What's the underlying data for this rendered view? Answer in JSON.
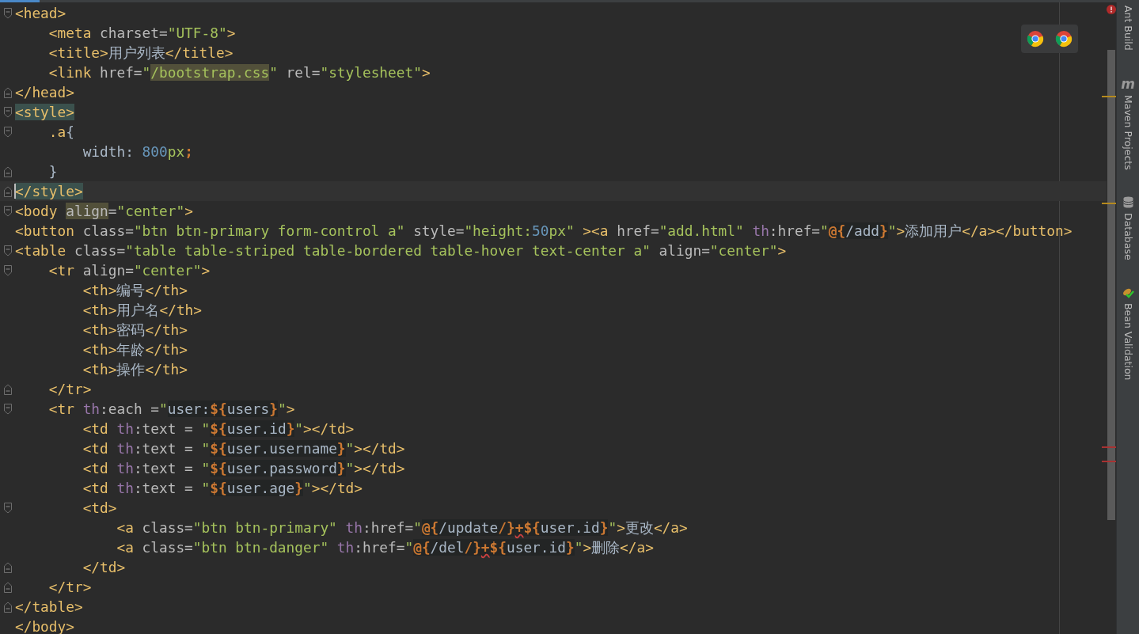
{
  "editor": {
    "lines": [
      {
        "fold_open": true,
        "tokens": [
          {
            "kind": "tag",
            "text": "<head>"
          }
        ],
        "children": [
          {
            "tokens": [
              {
                "kind": "tag",
                "text": "<meta"
              },
              {
                "kind": "attr",
                "text": " charset="
              },
              {
                "kind": "value",
                "text": "\"UTF-8\""
              },
              {
                "kind": "tag",
                "text": ">"
              }
            ]
          },
          {
            "tokens": [
              {
                "kind": "tag",
                "text": "<title>"
              },
              {
                "kind": "plain",
                "text": "用户列表"
              },
              {
                "kind": "tag",
                "text": "</title>"
              }
            ]
          },
          {
            "tokens": [
              {
                "kind": "tag",
                "text": "<link"
              },
              {
                "kind": "attr",
                "text": " href="
              },
              {
                "kind": "value",
                "text": "\""
              },
              {
                "kind": "value_usage",
                "text": "/bootstrap.css"
              },
              {
                "kind": "value",
                "text": "\""
              },
              {
                "kind": "attr",
                "text": " rel="
              },
              {
                "kind": "value",
                "text": "\"stylesheet\""
              },
              {
                "kind": "tag",
                "text": ">"
              }
            ]
          }
        ]
      },
      {
        "fold_close": true,
        "tokens": [
          {
            "kind": "tag",
            "text": "</head>"
          }
        ]
      },
      {
        "fold_open": true,
        "tokens": [
          {
            "kind": "tag_match",
            "text": "<style>"
          }
        ],
        "children": [
          {
            "fold_open": true,
            "tokens": [
              {
                "kind": "tag",
                "text": ".a"
              },
              {
                "kind": "plain",
                "text": "{"
              }
            ],
            "children": [
              {
                "tokens": [
                  {
                    "kind": "plain",
                    "text": "width: "
                  },
                  {
                    "kind": "number",
                    "text": "800"
                  },
                  {
                    "kind": "value",
                    "text": "px"
                  },
                  {
                    "kind": "punct",
                    "text": ";"
                  }
                ]
              }
            ]
          },
          {
            "fold_close": true,
            "tokens": [
              {
                "kind": "plain",
                "text": "}"
              }
            ]
          }
        ]
      },
      {
        "fold_close": true,
        "current": true,
        "tokens": [
          {
            "kind": "tag_match",
            "text": "</style>"
          }
        ]
      },
      {
        "fold_open": true,
        "tokens": [
          {
            "kind": "tag",
            "text": "<body "
          },
          {
            "kind": "attr_usage",
            "text": "align"
          },
          {
            "kind": "attr",
            "text": "="
          },
          {
            "kind": "value",
            "text": "\"center\""
          },
          {
            "kind": "tag",
            "text": ">"
          }
        ]
      },
      {
        "tokens": [
          {
            "kind": "tag",
            "text": "<button"
          },
          {
            "kind": "attr",
            "text": " class="
          },
          {
            "kind": "value",
            "text": "\"btn btn-primary form-control a\""
          },
          {
            "kind": "attr",
            "text": " style="
          },
          {
            "kind": "value",
            "text": "\"height:"
          },
          {
            "kind": "number",
            "text": "50"
          },
          {
            "kind": "value",
            "text": "px\""
          },
          {
            "kind": "tag",
            "text": " ><a"
          },
          {
            "kind": "attr",
            "text": " href="
          },
          {
            "kind": "value",
            "text": "\"add.html\""
          },
          {
            "kind": "prefix",
            "text": " th"
          },
          {
            "kind": "attr",
            "text": ":href="
          },
          {
            "kind": "value",
            "text": "\""
          },
          {
            "kind": "punct_expr",
            "text": "@{"
          },
          {
            "kind": "plain_expr",
            "text": "/add"
          },
          {
            "kind": "punct_expr",
            "text": "}"
          },
          {
            "kind": "value",
            "text": "\""
          },
          {
            "kind": "tag",
            "text": ">"
          },
          {
            "kind": "plain",
            "text": "添加用户"
          },
          {
            "kind": "tag",
            "text": "</a></button>"
          }
        ]
      },
      {
        "fold_open": true,
        "tokens": [
          {
            "kind": "tag",
            "text": "<table"
          },
          {
            "kind": "attr",
            "text": " class="
          },
          {
            "kind": "value",
            "text": "\"table table-striped table-bordered table-hover text-center a\""
          },
          {
            "kind": "attr",
            "text": " align="
          },
          {
            "kind": "value",
            "text": "\"center\""
          },
          {
            "kind": "tag",
            "text": ">"
          }
        ],
        "children": [
          {
            "fold_open": true,
            "tokens": [
              {
                "kind": "tag",
                "text": "<tr"
              },
              {
                "kind": "attr",
                "text": " align="
              },
              {
                "kind": "value",
                "text": "\"center\""
              },
              {
                "kind": "tag",
                "text": ">"
              }
            ],
            "children": [
              {
                "tokens": [
                  {
                    "kind": "tag",
                    "text": "<th>"
                  },
                  {
                    "kind": "plain",
                    "text": "编号"
                  },
                  {
                    "kind": "tag",
                    "text": "</th>"
                  }
                ]
              },
              {
                "tokens": [
                  {
                    "kind": "tag",
                    "text": "<th>"
                  },
                  {
                    "kind": "plain",
                    "text": "用户名"
                  },
                  {
                    "kind": "tag",
                    "text": "</th>"
                  }
                ]
              },
              {
                "tokens": [
                  {
                    "kind": "tag",
                    "text": "<th>"
                  },
                  {
                    "kind": "plain",
                    "text": "密码"
                  },
                  {
                    "kind": "tag",
                    "text": "</th>"
                  }
                ]
              },
              {
                "tokens": [
                  {
                    "kind": "tag",
                    "text": "<th>"
                  },
                  {
                    "kind": "plain",
                    "text": "年龄"
                  },
                  {
                    "kind": "tag",
                    "text": "</th>"
                  }
                ]
              },
              {
                "tokens": [
                  {
                    "kind": "tag",
                    "text": "<th>"
                  },
                  {
                    "kind": "plain",
                    "text": "操作"
                  },
                  {
                    "kind": "tag",
                    "text": "</th>"
                  }
                ]
              }
            ]
          },
          {
            "fold_close": true,
            "tokens": [
              {
                "kind": "tag",
                "text": "</tr>"
              }
            ]
          },
          {
            "fold_open": true,
            "tokens": [
              {
                "kind": "tag",
                "text": "<tr"
              },
              {
                "kind": "prefix",
                "text": " th"
              },
              {
                "kind": "attr",
                "text": ":each ="
              },
              {
                "kind": "value",
                "text": "\""
              },
              {
                "kind": "plain_expr",
                "text": "user:"
              },
              {
                "kind": "punct_expr",
                "text": "${"
              },
              {
                "kind": "plain_expr",
                "text": "users"
              },
              {
                "kind": "punct_expr",
                "text": "}"
              },
              {
                "kind": "value",
                "text": "\""
              },
              {
                "kind": "tag",
                "text": ">"
              }
            ],
            "children": [
              {
                "tokens": [
                  {
                    "kind": "tag",
                    "text": "<td"
                  },
                  {
                    "kind": "prefix",
                    "text": " th"
                  },
                  {
                    "kind": "attr",
                    "text": ":text = "
                  },
                  {
                    "kind": "value",
                    "text": "\""
                  },
                  {
                    "kind": "punct_expr",
                    "text": "${"
                  },
                  {
                    "kind": "plain_expr",
                    "text": "user.id"
                  },
                  {
                    "kind": "punct_expr",
                    "text": "}"
                  },
                  {
                    "kind": "value",
                    "text": "\""
                  },
                  {
                    "kind": "tag",
                    "text": "></td>"
                  }
                ]
              },
              {
                "tokens": [
                  {
                    "kind": "tag",
                    "text": "<td"
                  },
                  {
                    "kind": "prefix",
                    "text": " th"
                  },
                  {
                    "kind": "attr",
                    "text": ":text = "
                  },
                  {
                    "kind": "value",
                    "text": "\""
                  },
                  {
                    "kind": "punct_expr",
                    "text": "${"
                  },
                  {
                    "kind": "plain_expr",
                    "text": "user.username"
                  },
                  {
                    "kind": "punct_expr",
                    "text": "}"
                  },
                  {
                    "kind": "value",
                    "text": "\""
                  },
                  {
                    "kind": "tag",
                    "text": "></td>"
                  }
                ]
              },
              {
                "tokens": [
                  {
                    "kind": "tag",
                    "text": "<td"
                  },
                  {
                    "kind": "prefix",
                    "text": " th"
                  },
                  {
                    "kind": "attr",
                    "text": ":text = "
                  },
                  {
                    "kind": "value",
                    "text": "\""
                  },
                  {
                    "kind": "punct_expr",
                    "text": "${"
                  },
                  {
                    "kind": "plain_expr",
                    "text": "user.password"
                  },
                  {
                    "kind": "punct_expr",
                    "text": "}"
                  },
                  {
                    "kind": "value",
                    "text": "\""
                  },
                  {
                    "kind": "tag",
                    "text": "></td>"
                  }
                ]
              },
              {
                "tokens": [
                  {
                    "kind": "tag",
                    "text": "<td"
                  },
                  {
                    "kind": "prefix",
                    "text": " th"
                  },
                  {
                    "kind": "attr",
                    "text": ":text = "
                  },
                  {
                    "kind": "value",
                    "text": "\""
                  },
                  {
                    "kind": "punct_expr",
                    "text": "${"
                  },
                  {
                    "kind": "plain_expr",
                    "text": "user.age"
                  },
                  {
                    "kind": "punct_expr",
                    "text": "}"
                  },
                  {
                    "kind": "value",
                    "text": "\""
                  },
                  {
                    "kind": "tag",
                    "text": "></td>"
                  }
                ]
              },
              {
                "fold_open": true,
                "tokens": [
                  {
                    "kind": "tag",
                    "text": "<td>"
                  }
                ],
                "children": [
                  {
                    "tokens": [
                      {
                        "kind": "tag",
                        "text": "<a"
                      },
                      {
                        "kind": "attr",
                        "text": " class="
                      },
                      {
                        "kind": "value",
                        "text": "\"btn btn-primary\""
                      },
                      {
                        "kind": "prefix",
                        "text": " th"
                      },
                      {
                        "kind": "attr",
                        "text": ":href="
                      },
                      {
                        "kind": "value",
                        "text": "\""
                      },
                      {
                        "kind": "punct_expr",
                        "text": "@{"
                      },
                      {
                        "kind": "plain_expr",
                        "text": "/update"
                      },
                      {
                        "kind": "punct_expr",
                        "text": "/}"
                      },
                      {
                        "kind": "punct_typo",
                        "text": "+"
                      },
                      {
                        "kind": "punct_expr",
                        "text": "${"
                      },
                      {
                        "kind": "plain_expr",
                        "text": "user.id"
                      },
                      {
                        "kind": "punct_expr",
                        "text": "}"
                      },
                      {
                        "kind": "value",
                        "text": "\""
                      },
                      {
                        "kind": "tag",
                        "text": ">"
                      },
                      {
                        "kind": "plain",
                        "text": "更改"
                      },
                      {
                        "kind": "tag",
                        "text": "</a>"
                      }
                    ]
                  },
                  {
                    "tokens": [
                      {
                        "kind": "tag",
                        "text": "<a"
                      },
                      {
                        "kind": "attr",
                        "text": " class="
                      },
                      {
                        "kind": "value",
                        "text": "\"btn btn-danger\""
                      },
                      {
                        "kind": "prefix",
                        "text": " th"
                      },
                      {
                        "kind": "attr",
                        "text": ":href="
                      },
                      {
                        "kind": "value",
                        "text": "\""
                      },
                      {
                        "kind": "punct_expr",
                        "text": "@{"
                      },
                      {
                        "kind": "plain_expr",
                        "text": "/del"
                      },
                      {
                        "kind": "punct_expr",
                        "text": "/}"
                      },
                      {
                        "kind": "punct_typo",
                        "text": "+"
                      },
                      {
                        "kind": "punct_expr",
                        "text": "${"
                      },
                      {
                        "kind": "plain_expr",
                        "text": "user.id"
                      },
                      {
                        "kind": "punct_expr",
                        "text": "}"
                      },
                      {
                        "kind": "value",
                        "text": "\""
                      },
                      {
                        "kind": "tag",
                        "text": ">"
                      },
                      {
                        "kind": "plain",
                        "text": "删除"
                      },
                      {
                        "kind": "tag",
                        "text": "</a>"
                      }
                    ]
                  }
                ]
              },
              {
                "fold_close": true,
                "tokens": [
                  {
                    "kind": "tag",
                    "text": "</td>"
                  }
                ]
              }
            ]
          },
          {
            "fold_close": true,
            "tokens": [
              {
                "kind": "tag",
                "text": "</tr>"
              }
            ]
          }
        ]
      },
      {
        "fold_close": true,
        "tokens": [
          {
            "kind": "tag",
            "text": "</table>"
          }
        ]
      },
      {
        "tokens": [
          {
            "kind": "tag",
            "text": "</body>"
          }
        ]
      }
    ]
  },
  "tool_windows": [
    {
      "kind": "ant",
      "label": "Ant Build"
    },
    {
      "kind": "maven",
      "label": "Maven Projects",
      "icon_text": "m"
    },
    {
      "kind": "database",
      "label": "Database"
    },
    {
      "kind": "bean",
      "label": "Bean Validation"
    }
  ]
}
